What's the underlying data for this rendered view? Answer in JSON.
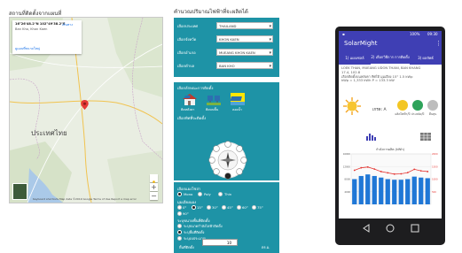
{
  "map": {
    "title": "สถานที่ติดตั้งจากแผนที่",
    "info_coords": "16°26'48.2\"N 102°49'38.2\"E",
    "info_location": "Ban Kho, Khon Kaen",
    "info_directions": "เส้นทาง",
    "info_larger": "ดูแผนที่ขนาดใหญ่",
    "country_label": "ประเทศไทย",
    "zoom_in": "+",
    "zoom_out": "−",
    "attribution": "Keyboard shortcuts  Map data ©2019 Google  Terms of Use  Report a map error"
  },
  "settings": {
    "title": "คำนวณปริมาณไฟฟ้าที่จะผลิตได้",
    "rows": [
      {
        "label": "เลือกประเทศ",
        "value": "THAILAND"
      },
      {
        "label": "เลือกจังหวัด",
        "value": "KHON KAEN"
      },
      {
        "label": "เลือกอำเภอ",
        "value": "MUEANG KHON KAEN"
      },
      {
        "label": "เลือกตำบล",
        "value": "BAN KHO"
      }
    ],
    "type_header": "เลือกลักษณะการติดตั้ง",
    "type_options": [
      "ติดหลังคา",
      "ติดบนพื้น",
      "ลอยน้ำ"
    ],
    "direction_header": "เลือกทิศที่จะติดตั้ง",
    "panel_header": "เลือกแผงโซล่า",
    "panel_options": [
      "Mono",
      "Poly",
      "Thin"
    ],
    "angle_header": "มุมเอียงแผง",
    "angle_options": [
      "0°",
      "15°",
      "30°",
      "45°",
      "60°",
      "75°",
      "90°"
    ],
    "size_header": "ระบุขนาดพื้นที่ติดตั้ง",
    "size_options": [
      "ระบุขนาดกำลังไฟฟ้าติดตั้ง",
      "ระบุพื้นที่ติดตั้ง",
      "ระบุงบประมาณ"
    ],
    "area_label": "พื้นที่ติดตั้ง",
    "area_value": "10",
    "area_unit": "ตร.ม."
  },
  "app": {
    "status_time": "09:30",
    "status_battery": "100%",
    "title": "SolarMight",
    "menu_icon": "kebab-menu-icon",
    "tabs": [
      "1) แผงเซลล์",
      "2) เลือกวิธีการ การติดตั้ง",
      "3) ผลลัพธ์"
    ],
    "info_line1": "LOEK THAN, MUEANG UDON THANI, BAN KHANG",
    "info_line2": "17.4, 102.8",
    "info_line3": "เลือกติดตั้งบนหลังคา ทิศใต้ มุมเอียง 15° 1.5 kWp",
    "info_line4": "kWp = 1,333 kWh    P = 133.3 kW",
    "grade": "เกรด: A",
    "round_caps": [
      "ผลิตไฟฟ้า/ปี",
      "ประหยัด/ปี",
      "คืนทุน"
    ],
    "chart_title": "กำลังการผลิต (kWh)",
    "nav": [
      "back",
      "home",
      "recent"
    ]
  },
  "chart_data": {
    "type": "bar",
    "title": "",
    "categories": [
      "1",
      "2",
      "3",
      "4",
      "5",
      "6",
      "7",
      "8",
      "9",
      "10",
      "11",
      "12"
    ],
    "series": [
      {
        "values": [
          8000,
          9000,
          9500,
          9000,
          8500,
          8000,
          7800,
          7800,
          8000,
          8800,
          8500,
          8300
        ]
      },
      {
        "values": [
          1350,
          1450,
          1480,
          1400,
          1300,
          1250,
          1200,
          1210,
          1260,
          1390,
          1330,
          1300
        ]
      }
    ],
    "y_ticks": [
      "16000",
      "12000",
      "8000",
      "4000"
    ],
    "y2_ticks": [
      "2000",
      "1500",
      "1000",
      "500"
    ],
    "colors": {
      "bar": "#1f77d6",
      "line": "#e53935"
    }
  }
}
